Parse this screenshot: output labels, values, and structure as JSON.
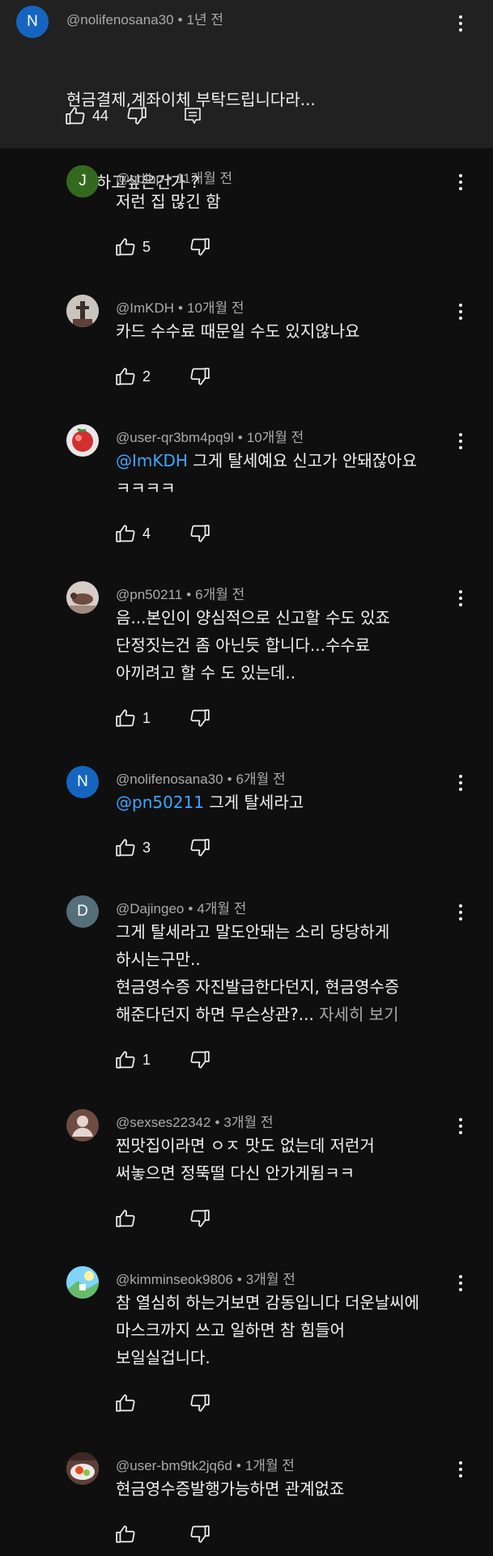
{
  "parent": {
    "avatar_letter": "N",
    "avatar_color": "#1565c0",
    "author": "@nolifenosana30",
    "time": "1년 전",
    "lines": [
      "현금결제,계좌이체 부탁드립니다라...",
      "탈세하고싶은건가 ?"
    ],
    "likes": "44"
  },
  "replies": [
    {
      "author": "@qdlbp",
      "time": "11개월 전",
      "avatar": "letter",
      "avatar_letter": "J",
      "avatar_color": "#33691e",
      "lines": [
        "저런 집 많긴 함"
      ],
      "likes": "5"
    },
    {
      "author": "@ImKDH",
      "time": "10개월 전",
      "avatar": "photo-tower",
      "avatar_color": "#b9b4ad",
      "lines": [
        "카드 수수료 때문일 수도 있지않나요"
      ],
      "likes": "2"
    },
    {
      "author": "@user-qr3bm4pq9l",
      "time": "10개월 전",
      "avatar": "photo-red",
      "avatar_color": "#d32f2f",
      "mention": "@ImKDH",
      "lines": [
        "그게 탈세예요 신고가 안돼잖아요",
        "ㅋㅋㅋㅋ"
      ],
      "likes": "4"
    },
    {
      "author": "@pn50211",
      "time": "6개월 전",
      "avatar": "photo-animal",
      "avatar_color": "#a1887f",
      "lines": [
        "음...본인이 양심적으로 신고할 수도 있죠",
        "단정짓는건 좀 아닌듯 합니다...수수료",
        "아끼려고 할 수 도 있는데.."
      ],
      "likes": "1"
    },
    {
      "author": "@nolifenosana30",
      "time": "6개월 전",
      "avatar": "letter",
      "avatar_letter": "N",
      "avatar_color": "#1565c0",
      "mention": "@pn50211",
      "lines": [
        "그게 탈세라고"
      ],
      "likes": "3"
    },
    {
      "author": "@Dajingeo",
      "time": "4개월 전",
      "avatar": "letter",
      "avatar_letter": "D",
      "avatar_color": "#546e7a",
      "lines": [
        "그게 탈세라고 말도안돼는 소리 당당하게",
        "하시는구만..",
        "현금영수증 자진발급한다던지, 현금영수증",
        "해준다던지 하면 무슨상관?..."
      ],
      "more": "자세히 보기",
      "likes": "1"
    },
    {
      "author": "@sexses22342",
      "time": "3개월 전",
      "avatar": "default",
      "avatar_color": "#6d4c41",
      "lines": [
        "찐맛집이라면 ㅇㅈ 맛도 없는데 저런거",
        "써놓으면 정뚝떨 다신 안가게됨ㅋㅋ"
      ],
      "likes": ""
    },
    {
      "author": "@kimminseok9806",
      "time": "3개월 전",
      "avatar": "photo-landscape",
      "avatar_color": "#4fc3f7",
      "lines": [
        "참 열심히 하는거보면 감동입니다 더운날씨에",
        "마스크까지 쓰고 일하면 참 힘들어",
        "보일실겁니다."
      ],
      "likes": ""
    },
    {
      "author": "@user-bm9tk2jq6d",
      "time": "1개월 전",
      "avatar": "photo-food",
      "avatar_color": "#8d6e63",
      "lines": [
        "현금영수증발행가능하면 관계없죠"
      ],
      "likes": ""
    }
  ]
}
